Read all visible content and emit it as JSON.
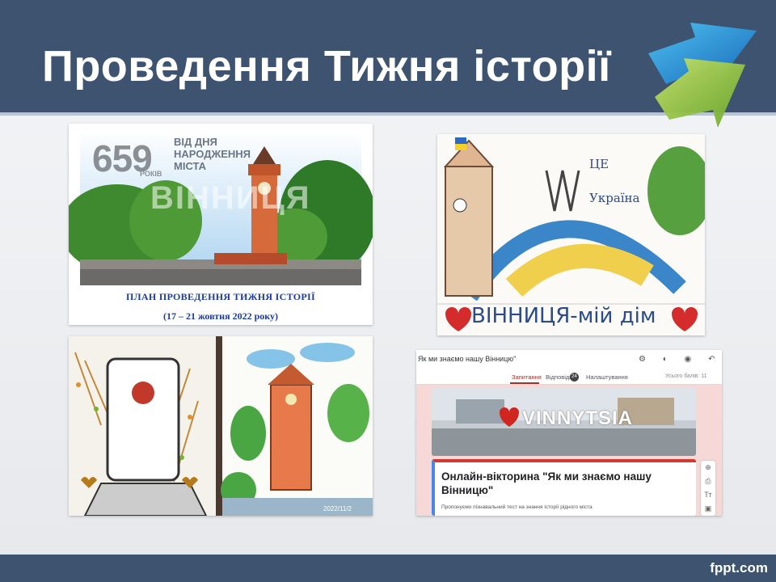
{
  "slide": {
    "title": "Проведення Тижня історії",
    "footer_brand": "fppt.com"
  },
  "poster": {
    "big_number": "659",
    "years_label": "РОКІВ",
    "from_day_label": "ВІД ДНЯ НАРОДЖЕННЯ МІСТА",
    "city_name": "ВІННИЦЯ",
    "plan_title": "ПЛАН ПРОВЕДЕННЯ ТИЖНЯ ІСТОРІЇ",
    "plan_dates": "(17 – 21 жовтня 2022 року)"
  },
  "drawing_top_right": {
    "line1": "ЦЕ",
    "line2": "Україна",
    "caption": "ВІННИЦЯ-мій дім"
  },
  "drawing_bottom_left": {
    "timestamp": "2022/11/2"
  },
  "form": {
    "doc_title": "Як ми знаємо нашу Вінницю\"",
    "tabs": [
      "Запитання",
      "Відповіді",
      "Налаштування"
    ],
    "responses_count": "24",
    "total_score": "Усього балів: 11",
    "banner_text": "VINNYTSIA",
    "quiz_title": "Онлайн-вікторина \"Як ми знаємо нашу Вінницю\"",
    "quiz_description": "Пропонуємо пізнавальний тест на знання історії рідного міста",
    "side_tools": [
      "⊕",
      "⎙",
      "Tт",
      "▣"
    ],
    "header_icons": "⚙ ◐ ◉ ↶ ↷"
  },
  "colors": {
    "title_bar": "#3d5370",
    "plan_text": "#1c3aa0",
    "arrow_blue": "#1d8fd6",
    "arrow_green": "#8cc63f"
  }
}
